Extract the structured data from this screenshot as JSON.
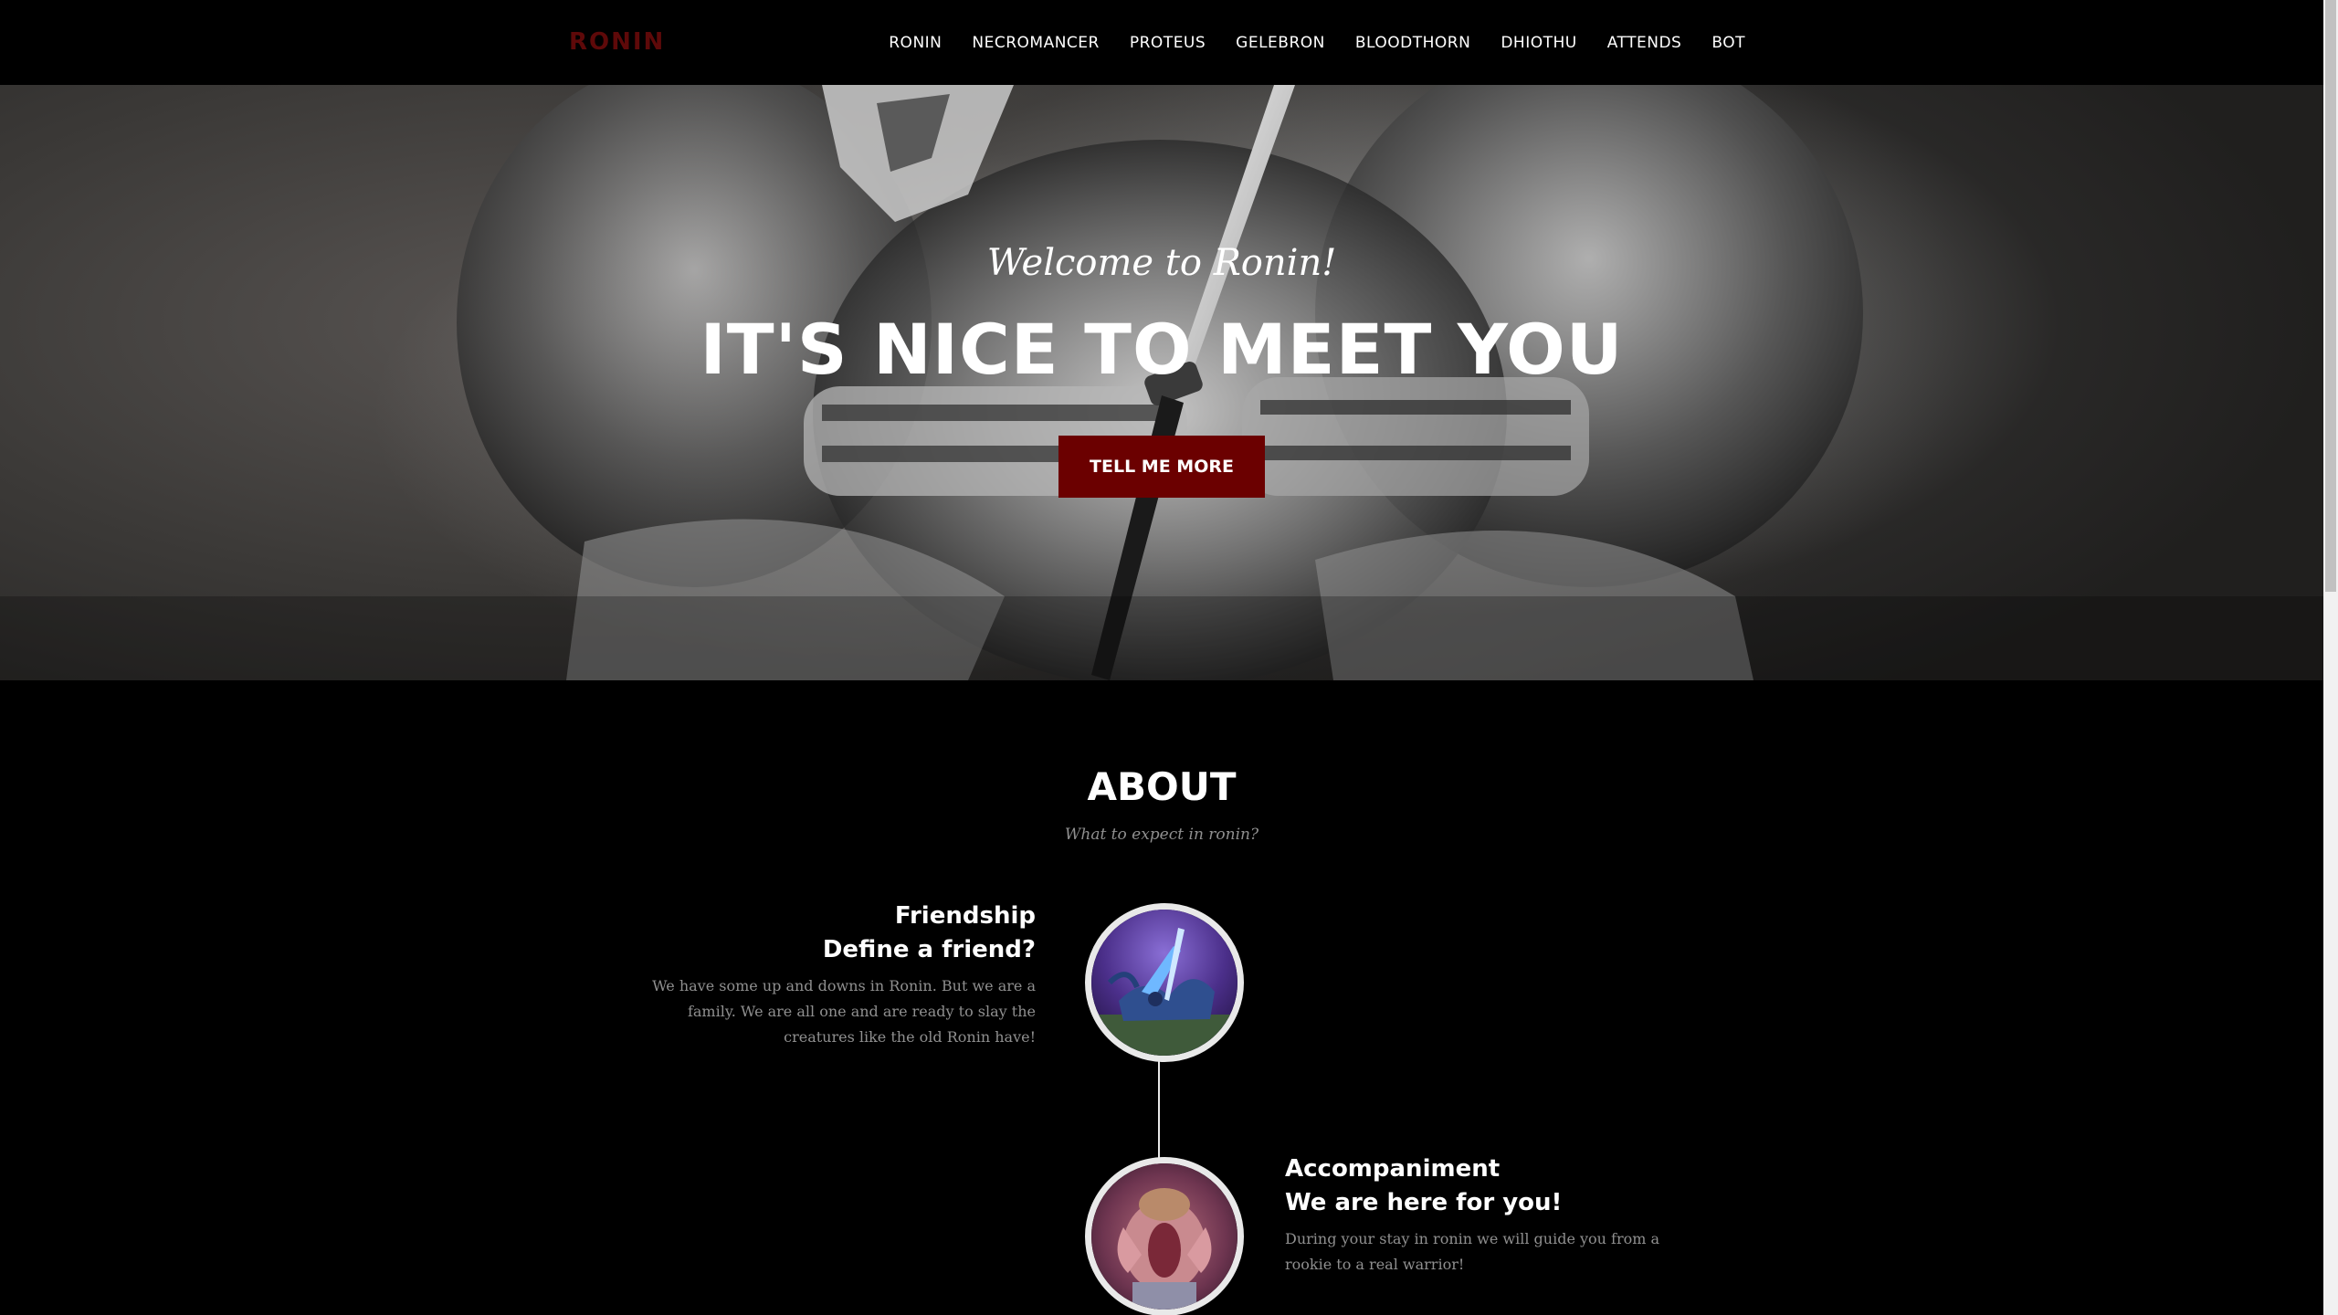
{
  "nav": {
    "brand": "RONIN",
    "items": [
      {
        "label": "RONIN"
      },
      {
        "label": "NECROMANCER"
      },
      {
        "label": "PROTEUS"
      },
      {
        "label": "GELEBRON"
      },
      {
        "label": "BLOODTHORN"
      },
      {
        "label": "DHIOTHU"
      },
      {
        "label": "ATTENDS"
      },
      {
        "label": "BOT"
      }
    ]
  },
  "hero": {
    "subtitle": "Welcome to Ronin!",
    "title": "IT'S NICE TO MEET YOU",
    "button_label": "TELL ME MORE"
  },
  "about": {
    "heading": "ABOUT",
    "subheading": "What to expect in ronin?",
    "timeline": [
      {
        "heading_line1": "Friendship",
        "heading_line2": "Define a friend?",
        "body": "We have some up and downs in Ronin. But we are a family. We are all one and are ready to slay the creatures like the old Ronin have!"
      },
      {
        "heading_line1": "Accompaniment",
        "heading_line2": "We are here for you!",
        "body": "During your stay in ronin we will guide you from a rookie to a real warrior!"
      }
    ]
  },
  "colors": {
    "brand": "#5e0909",
    "button": "#6b0000",
    "background": "#000000",
    "muted_text": "#8f8f8f"
  }
}
